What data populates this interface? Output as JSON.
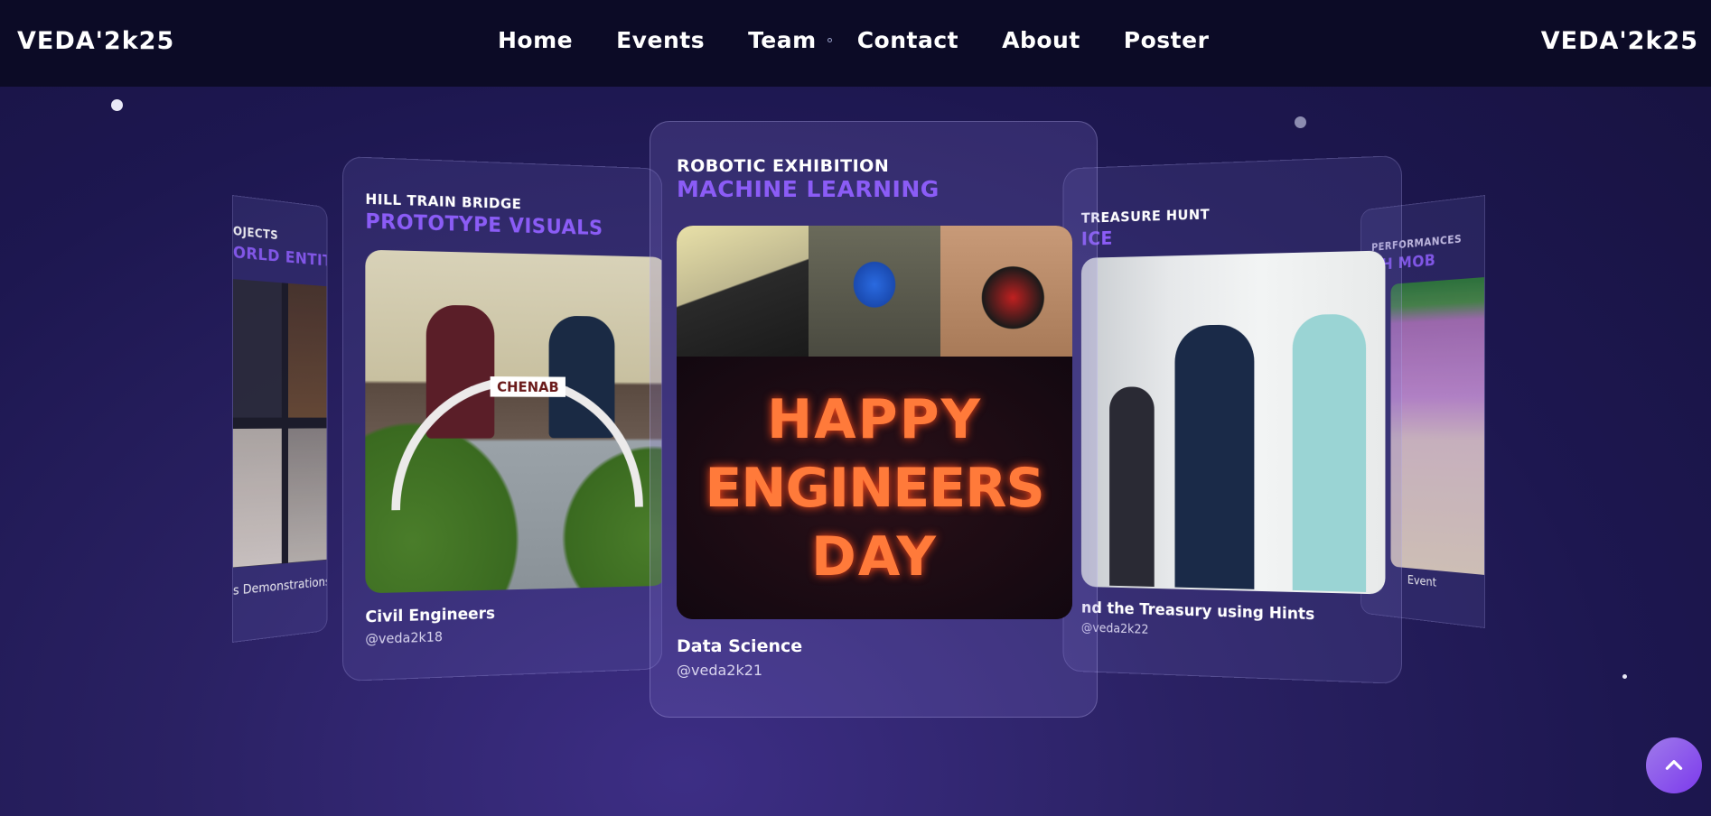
{
  "nav": {
    "brand_left": "VEDA'2k25",
    "brand_right": "VEDA'2k25",
    "links": [
      "Home",
      "Events",
      "Team",
      "Contact",
      "About",
      "Poster"
    ]
  },
  "cards": {
    "far_left": {
      "kicker": "OJECTS",
      "headline": "ORLD ENTITIES",
      "caption": "s Demonstrations"
    },
    "left": {
      "kicker": "HILL TRAIN BRIDGE",
      "headline": "PROTOTYPE VISUALS",
      "caption": "Civil Engineers",
      "handle": "@veda2k18",
      "banner": "CHENAB"
    },
    "center": {
      "kicker": "ROBOTIC EXHIBITION",
      "headline": "MACHINE LEARNING",
      "caption": "Data Science",
      "handle": "@veda2k21",
      "led_lines": [
        "HAPPY",
        "ENGINEERS",
        "DAY"
      ]
    },
    "right": {
      "kicker": "TREASURE HUNT",
      "headline": "ICE",
      "caption": "nd the Treasury using Hints",
      "handle": "@veda2k22"
    },
    "far_right": {
      "kicker": "PERFORMANCES",
      "headline": "SH MOB",
      "caption": "Event"
    }
  },
  "colors": {
    "accent": "#8b5cf6",
    "nav_bg": "#0c0b26",
    "button": "#8b5cf6"
  },
  "icons": {
    "scroll_top": "chevron-up-icon"
  }
}
